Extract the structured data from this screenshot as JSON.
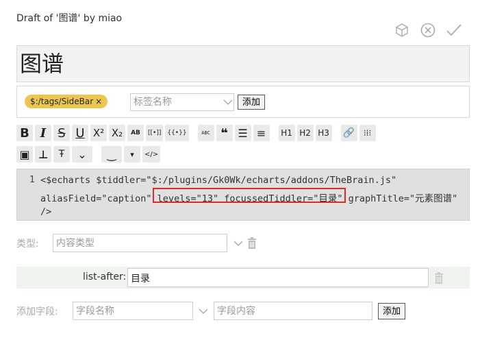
{
  "header": {
    "draft_title": "Draft of '图谱' by miao",
    "icons": [
      "cube-icon",
      "cancel-circle-icon",
      "checkmark-icon"
    ]
  },
  "title_field": {
    "value": "图谱"
  },
  "tags": {
    "items": [
      {
        "label": "$:/tags/SideBar",
        "remove": "×"
      }
    ],
    "input_placeholder": "标签名称",
    "add_label": "添加",
    "pill_color": "#ecc750"
  },
  "toolbar": {
    "row1": [
      {
        "name": "bold-button",
        "label": "B"
      },
      {
        "name": "italic-button",
        "label": "I"
      },
      {
        "name": "strikethrough-button",
        "label": "S"
      },
      {
        "name": "underline-button",
        "label": "U"
      },
      {
        "name": "superscript-button",
        "label": "X²"
      },
      {
        "name": "subscript-button",
        "label": "X₂"
      },
      {
        "name": "smallcaps-button",
        "label": "AB"
      },
      {
        "name": "transclude-button",
        "label": "[[•]]"
      },
      {
        "name": "macro-button",
        "label": "{{•}}"
      },
      {
        "name": "monospace-block-button",
        "label": "ABC"
      },
      {
        "name": "quote-button",
        "label": "❝"
      },
      {
        "name": "bullet-list-button",
        "label": "☰"
      },
      {
        "name": "number-list-button",
        "label": "≡"
      },
      {
        "name": "heading1-button",
        "label": "H1"
      },
      {
        "name": "heading2-button",
        "label": "H2"
      },
      {
        "name": "heading3-button",
        "label": "H3"
      },
      {
        "name": "link-button",
        "label": "🔗"
      },
      {
        "name": "preview-type-button",
        "label": "⁝⁞⁝"
      }
    ],
    "row2": [
      {
        "name": "picture-button",
        "label": "▣"
      },
      {
        "name": "stamp-button",
        "label": "⊥"
      },
      {
        "name": "text-size-button",
        "label": "Ŧ"
      },
      {
        "name": "more-button",
        "label": "⌄"
      },
      {
        "name": "preview-button",
        "label": "‿"
      },
      {
        "name": "preview-dropdown-button",
        "label": "▾"
      },
      {
        "name": "code-button",
        "label": "</>"
      }
    ]
  },
  "editor": {
    "line_number": "1",
    "lines": [
      "<$echarts $tiddler=\"$:/plugins/Gk0Wk/echarts/addons/TheBrain.js\"",
      "aliasField=\"caption\" levels=\"13\" focussedTiddler=\"目录\" graphTitle=\"元素图谱\"",
      "/>"
    ],
    "highlight_color": "#e0282a"
  },
  "type_row": {
    "label": "类型:",
    "placeholder": "内容类型"
  },
  "list_after": {
    "label": "list-after:",
    "value": "目录"
  },
  "add_field": {
    "label": "添加字段:",
    "name_placeholder": "字段名称",
    "value_placeholder": "字段内容",
    "add_label": "添加"
  }
}
